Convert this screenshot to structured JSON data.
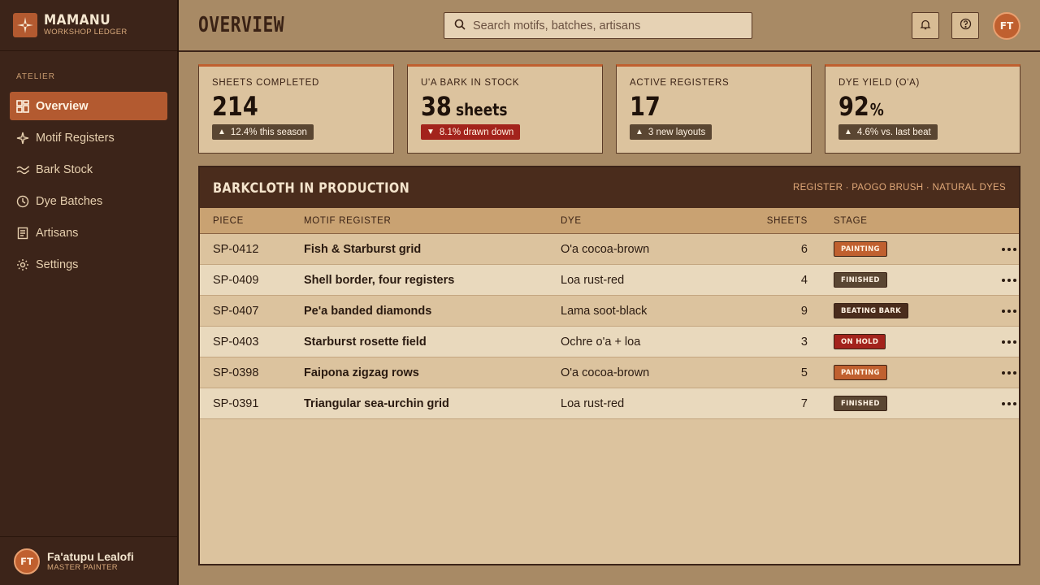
{
  "brand": {
    "name": "MAMANU",
    "subtitle": "WORKSHOP LEDGER"
  },
  "sidebar": {
    "section_label": "ATELIER",
    "items": [
      {
        "label": "Overview",
        "icon": "dashboard-icon",
        "active": true
      },
      {
        "label": "Motif Registers",
        "icon": "sparkle-icon",
        "active": false
      },
      {
        "label": "Bark Stock",
        "icon": "wave-icon",
        "active": false
      },
      {
        "label": "Dye Batches",
        "icon": "clock-icon",
        "active": false
      },
      {
        "label": "Artisans",
        "icon": "document-icon",
        "active": false
      },
      {
        "label": "Settings",
        "icon": "gear-icon",
        "active": false
      }
    ],
    "user": {
      "initials": "FT",
      "name": "Fa'atupu Lealofi",
      "role": "MASTER PAINTER"
    }
  },
  "header": {
    "title": "OVERVIEW",
    "search_placeholder": "Search motifs, batches, artisans",
    "avatar_initials": "FT"
  },
  "stats": [
    {
      "label": "SHEETS COMPLETED",
      "value": "214",
      "unit": "",
      "badge": "12.4% this season",
      "trend": "up"
    },
    {
      "label": "U'A BARK IN STOCK",
      "value": "38",
      "unit": "sheets",
      "badge": "8.1% drawn down",
      "trend": "down"
    },
    {
      "label": "ACTIVE REGISTERS",
      "value": "17",
      "unit": "",
      "badge": "3 new layouts",
      "trend": "up"
    },
    {
      "label": "DYE YIELD (O'A)",
      "value": "92",
      "unit": "%",
      "badge": "4.6% vs. last beat",
      "trend": "up"
    }
  ],
  "production": {
    "title": "BARKCLOTH IN PRODUCTION",
    "meta": "REGISTER · PAOGO BRUSH · NATURAL DYES",
    "columns": {
      "piece": "PIECE",
      "motif": "MOTIF REGISTER",
      "dye": "DYE",
      "sheets": "SHEETS",
      "stage": "STAGE"
    },
    "rows": [
      {
        "piece": "SP-0412",
        "motif": "Fish & Starburst grid",
        "dye": "O'a cocoa-brown",
        "sheets": "6",
        "stage": "PAINTING"
      },
      {
        "piece": "SP-0409",
        "motif": "Shell border, four registers",
        "dye": "Loa rust-red",
        "sheets": "4",
        "stage": "FINISHED"
      },
      {
        "piece": "SP-0407",
        "motif": "Pe'a banded diamonds",
        "dye": "Lama soot-black",
        "sheets": "9",
        "stage": "BEATING BARK"
      },
      {
        "piece": "SP-0403",
        "motif": "Starburst rosette field",
        "dye": "Ochre o'a + loa",
        "sheets": "3",
        "stage": "ON HOLD"
      },
      {
        "piece": "SP-0398",
        "motif": "Faipona zigzag rows",
        "dye": "O'a cocoa-brown",
        "sheets": "5",
        "stage": "PAINTING"
      },
      {
        "piece": "SP-0391",
        "motif": "Triangular sea-urchin grid",
        "dye": "Loa rust-red",
        "sheets": "7",
        "stage": "FINISHED"
      }
    ]
  },
  "stage_colors": {
    "PAINTING": "#c0602f",
    "FINISHED": "#5a4632",
    "BEATING BARK": "#4a2c1c",
    "ON HOLD": "#a3231c"
  },
  "colors": {
    "accent": "#b35a30",
    "sidebar": "#3c2419",
    "panel_head": "#4a2c1c",
    "background": "#a88a65"
  }
}
